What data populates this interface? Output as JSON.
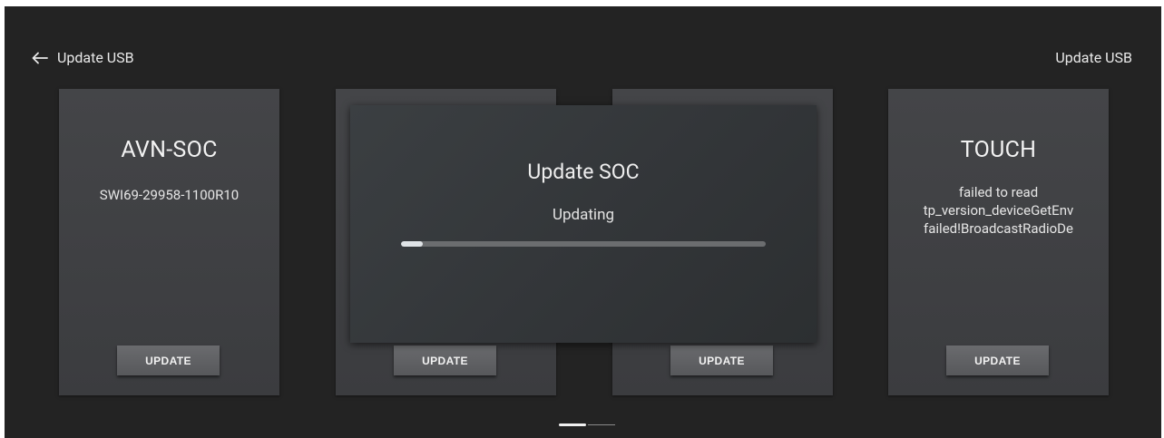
{
  "header": {
    "back_label": "Update USB",
    "title": "Update USB"
  },
  "cards": [
    {
      "title": "AVN-SOC",
      "version": "SWI69-29958-1100R10",
      "button_label": "UPDATE"
    },
    {
      "title": "",
      "version": "",
      "button_label": "UPDATE"
    },
    {
      "title": "",
      "version": "",
      "button_label": "UPDATE"
    },
    {
      "title": "TOUCH",
      "version_lines": [
        "failed to read",
        "tp_version_deviceGetEnv",
        "failed!BroadcastRadioDe"
      ],
      "button_label": "UPDATE"
    }
  ],
  "dialog": {
    "title": "Update SOC",
    "status": "Updating",
    "progress": 0.06
  },
  "pager": {
    "pages": 2,
    "current": 1
  },
  "colors": {
    "background": "#232323",
    "card": "#424346",
    "button": "#616265",
    "progress_fill": "#dfe3e6",
    "progress_track": "#6b6d6f"
  }
}
